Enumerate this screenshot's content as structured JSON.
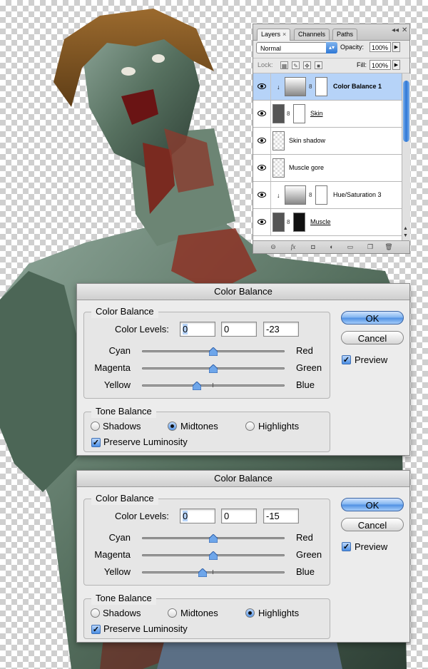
{
  "layers_panel": {
    "tabs": [
      {
        "label": "Layers",
        "close": "×"
      },
      {
        "label": "Channels"
      },
      {
        "label": "Paths"
      }
    ],
    "blend_mode": "Normal",
    "opacity_label": "Opacity:",
    "opacity_value": "100%",
    "lock_label": "Lock:",
    "fill_label": "Fill:",
    "fill_value": "100%",
    "layers": [
      {
        "name": "Color Balance 1",
        "selected": true
      },
      {
        "name": "Skin"
      },
      {
        "name": "Skin shadow"
      },
      {
        "name": "Muscle gore"
      },
      {
        "name": "Hue/Saturation 3"
      },
      {
        "name": "Muscle"
      }
    ],
    "bottom_icons": [
      "link-icon",
      "fx-icon",
      "mask-icon",
      "adjustment-icon",
      "group-icon",
      "new-layer-icon",
      "trash-icon"
    ]
  },
  "dialog_top": {
    "title": "Color Balance",
    "group_title": "Color Balance",
    "levels_label": "Color Levels:",
    "levels": [
      "0",
      "0",
      "-23"
    ],
    "sliders": [
      {
        "left": "Cyan",
        "right": "Red",
        "value": 0
      },
      {
        "left": "Magenta",
        "right": "Green",
        "value": 0
      },
      {
        "left": "Yellow",
        "right": "Blue",
        "value": -23
      }
    ],
    "tone_title": "Tone Balance",
    "tones": [
      "Shadows",
      "Midtones",
      "Highlights"
    ],
    "selected_tone": "Midtones",
    "preserve_label": "Preserve Luminosity",
    "preserve_checked": true,
    "ok_label": "OK",
    "cancel_label": "Cancel",
    "preview_label": "Preview",
    "preview_checked": true
  },
  "dialog_bottom": {
    "title": "Color Balance",
    "group_title": "Color Balance",
    "levels_label": "Color Levels:",
    "levels": [
      "0",
      "0",
      "-15"
    ],
    "sliders": [
      {
        "left": "Cyan",
        "right": "Red",
        "value": 0
      },
      {
        "left": "Magenta",
        "right": "Green",
        "value": 0
      },
      {
        "left": "Yellow",
        "right": "Blue",
        "value": -15
      }
    ],
    "tone_title": "Tone Balance",
    "tones": [
      "Shadows",
      "Midtones",
      "Highlights"
    ],
    "selected_tone": "Highlights",
    "preserve_label": "Preserve Luminosity",
    "preserve_checked": true,
    "ok_label": "OK",
    "cancel_label": "Cancel",
    "preview_label": "Preview",
    "preview_checked": true
  }
}
